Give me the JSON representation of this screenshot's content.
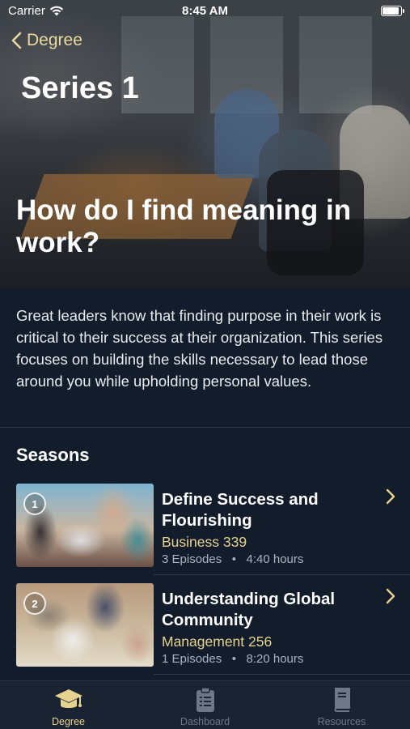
{
  "status_bar": {
    "carrier": "Carrier",
    "time": "8:45 AM"
  },
  "nav": {
    "back_label": "Degree"
  },
  "hero": {
    "series_title": "Series 1",
    "question": "How do I find meaning in work?"
  },
  "description": "Great leaders know that finding purpose in their work is critical to their success at their organization. This series focuses on building the skills necessary to lead those around you while upholding personal values.",
  "seasons_heading": "Seasons",
  "seasons": [
    {
      "number": "1",
      "title": "Define Success and Flourishing",
      "course": "Business 339",
      "episodes": "3 Episodes",
      "duration": "4:40 hours"
    },
    {
      "number": "2",
      "title": "Understanding Global Community",
      "course": "Management 256",
      "episodes": "1 Episodes",
      "duration": "8:20 hours"
    }
  ],
  "tabs": [
    {
      "label": "Degree",
      "icon": "graduation-cap-icon",
      "active": true
    },
    {
      "label": "Dashboard",
      "icon": "clipboard-icon",
      "active": false
    },
    {
      "label": "Resources",
      "icon": "book-icon",
      "active": false
    }
  ],
  "colors": {
    "background": "#121c2b",
    "accent": "#e6d38f",
    "tabbar": "#1a2331",
    "muted": "#aab3bf"
  }
}
